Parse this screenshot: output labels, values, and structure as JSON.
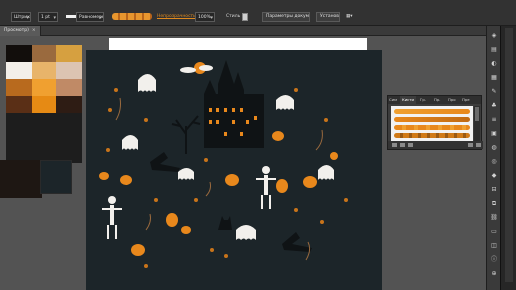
{
  "control_bar": {
    "style_dropdown": "Штрих",
    "stroke_weight": "1 pt",
    "profile_label": "Равномерный",
    "opacity_label": "Непрозрачность",
    "opacity_value": "100%",
    "styles_label": "Стиль",
    "doc_settings_button": "Параметры документа",
    "prefs_button": "Установки"
  },
  "document_tab": {
    "title": "Просмотр)",
    "close": "×"
  },
  "brushes_panel": {
    "tabs": [
      "Кисти",
      "Сим",
      "Гр.",
      "Пр.",
      "Про",
      "Пре"
    ],
    "active_tab": "Кисти"
  },
  "color_group": {
    "swatches": [
      [
        "#120e0c",
        "#9a6a3e",
        "#d6a040"
      ],
      [
        "#f3efe9",
        "#e8b46a",
        "#dcc4b2"
      ],
      [
        "#b86a1e",
        "#f0a030",
        "#c08a66"
      ],
      [
        "#5a2f16",
        "#e68a14",
        "#2e1c14"
      ]
    ],
    "left_block_color": "#1e1713",
    "right_block_color": "#1c2529"
  },
  "colors": {
    "art_background": "#1c2529",
    "orange": "#e8881c",
    "white": "#f2f0ec",
    "dark": "#0f1315"
  },
  "dock_icons": [
    "toggle-icon",
    "layers-icon",
    "color-icon",
    "swatches-icon",
    "brushes-icon",
    "symbols-icon",
    "stroke-icon",
    "gradient-icon",
    "transparency-icon",
    "appearance-icon",
    "graphic-styles-icon",
    "align-icon",
    "pathfinder-icon",
    "links-icon",
    "artboards-icon",
    "layers2-icon",
    "info-icon",
    "navigator-icon"
  ]
}
